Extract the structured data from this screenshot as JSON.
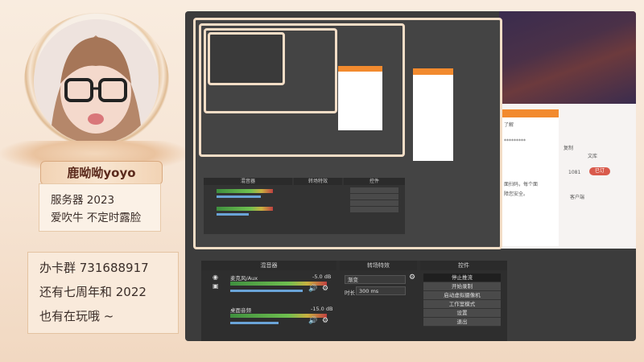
{
  "streamer": {
    "name": "鹿呦呦yoyo",
    "line1": "服务器   2023",
    "line2": "爱吹牛  不定时露脸"
  },
  "group": {
    "line1": "办卡群  731688917",
    "line2": "还有七周年和 2022",
    "line3": "也有在玩哦 ~"
  },
  "obs": {
    "docks": {
      "mixer": "混音器",
      "transitions": "转场特效",
      "controls": "控件"
    },
    "mixer_tracks": [
      {
        "name": "麦克风/Aux",
        "db": "-5.0 dB"
      },
      {
        "name": "桌面音频",
        "db": "-15.0 dB"
      }
    ],
    "transition": {
      "type": "渐变",
      "duration_label": "时长",
      "duration_value": "300 ms"
    },
    "controls": [
      "停止推流",
      "开始录制",
      "启动虚拟摄像机",
      "工作室模式",
      "设置",
      "退出"
    ]
  },
  "web": {
    "copy_label": "复制",
    "password_mask": "*********",
    "text1": "了解",
    "text2": "面扫码，每个面",
    "text3": "障您安全。",
    "tab1": "客户端",
    "tab2": "文库",
    "badge": "已订",
    "count": "1081"
  },
  "colors": {
    "accent_orange": "#f28a2e",
    "meter_green": "#6fbf4f",
    "slider_blue": "#6aa4d8"
  }
}
